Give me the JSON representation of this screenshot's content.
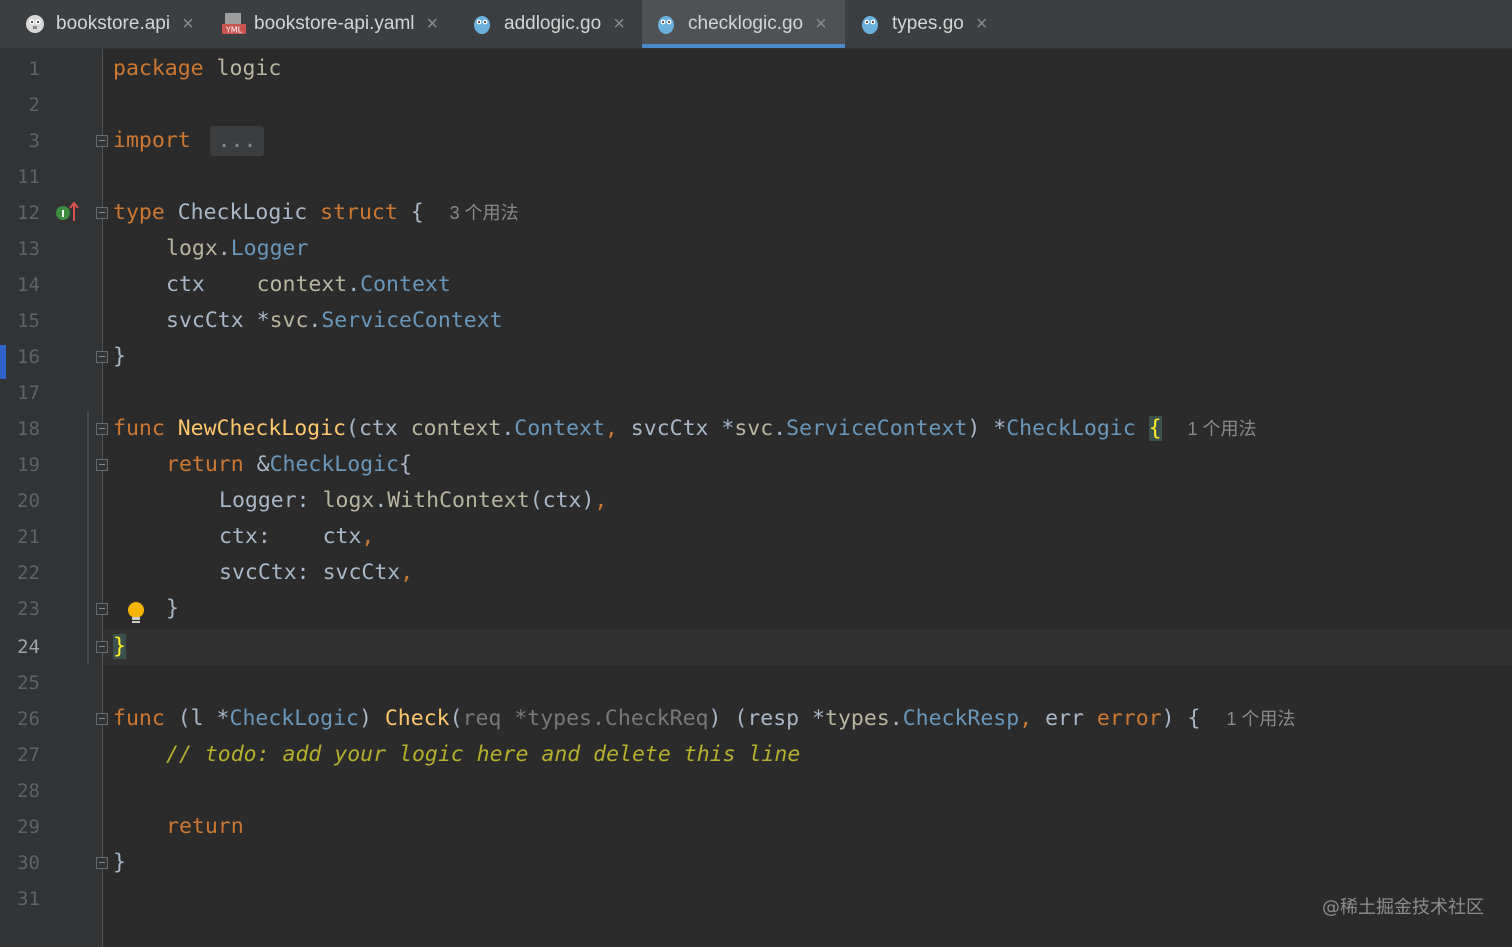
{
  "tabs": [
    {
      "label": "bookstore.api",
      "icon": "gopher-api-icon"
    },
    {
      "label": "bookstore-api.yaml",
      "icon": "yaml-file-icon",
      "icon_text": "YML"
    },
    {
      "label": "addlogic.go",
      "icon": "go-file-icon"
    },
    {
      "label": "checklogic.go",
      "icon": "go-file-icon",
      "active": true
    },
    {
      "label": "types.go",
      "icon": "go-file-icon"
    }
  ],
  "close_glyph": "×",
  "line_numbers": [
    "1",
    "2",
    "3",
    "11",
    "12",
    "13",
    "14",
    "15",
    "16",
    "17",
    "18",
    "19",
    "20",
    "21",
    "22",
    "23",
    "24",
    "25",
    "26",
    "27",
    "28",
    "29",
    "30",
    "31"
  ],
  "current_line": "24",
  "code": {
    "l1": {
      "kw": "package",
      "name": " logic"
    },
    "l3": {
      "kw": "import",
      "fold": "..."
    },
    "l12": {
      "kw": "type",
      "name": " CheckLogic ",
      "kw2": "struct",
      "brace": " {",
      "hint": "3 个用法"
    },
    "l13": {
      "pkg": "logx",
      "dot": ".",
      "type": "Logger"
    },
    "l14": {
      "field": "ctx    ",
      "pkg": "context",
      "dot": ".",
      "type": "Context"
    },
    "l15": {
      "field": "svcCtx ",
      "star": "*",
      "pkg": "svc",
      "dot": ".",
      "type": "ServiceContext"
    },
    "l16": {
      "text": "}"
    },
    "l18": {
      "kw": "func",
      "fn": " NewCheckLogic",
      "p1": "(ctx ",
      "pkg1": "context",
      "dot1": ".",
      "t1": "Context",
      "comma": ",",
      "p2": " svcCtx *",
      "pkg2": "svc",
      "dot2": ".",
      "t2": "ServiceContext",
      "p3": ") *",
      "t3": "CheckLogic",
      "sp": " ",
      "brace": "{",
      "hint": "1 个用法"
    },
    "l19": {
      "kw": "return",
      "amp": " &",
      "type": "CheckLogic",
      "brace": "{"
    },
    "l20": {
      "field": "Logger: ",
      "pkg": "logx",
      "dot": ".",
      "fn": "WithContext",
      "args": "(ctx)",
      "comma": ","
    },
    "l21": {
      "field": "ctx:    ",
      "val": "ctx",
      "comma": ","
    },
    "l22": {
      "field": "svcCtx: ",
      "val": "svcCtx",
      "comma": ","
    },
    "l23": {
      "text": "}"
    },
    "l24": {
      "text": "}"
    },
    "l26": {
      "kw": "func",
      "p1": " (l *",
      "t1": "CheckLogic",
      "p2": ") ",
      "fn": "Check",
      "p3": "(",
      "param": "req *types.CheckReq",
      "p4": ") (resp *",
      "pkg": "types",
      "dot": ".",
      "t2": "CheckResp",
      "comma": ",",
      "p5": " err ",
      "kw2": "error",
      "p6": ") {",
      "hint": "1 个用法"
    },
    "l27": {
      "comment": "// todo: add your logic here and delete this line"
    },
    "l29": {
      "kw": "return"
    },
    "l30": {
      "text": "}"
    }
  },
  "watermark": "@稀土掘金技术社区",
  "colors": {
    "background": "#2b2b2b",
    "gutter": "#313335",
    "accent": "#4a88c7",
    "keyword": "#cc7832",
    "function": "#ffc66d",
    "type": "#6897bb"
  }
}
